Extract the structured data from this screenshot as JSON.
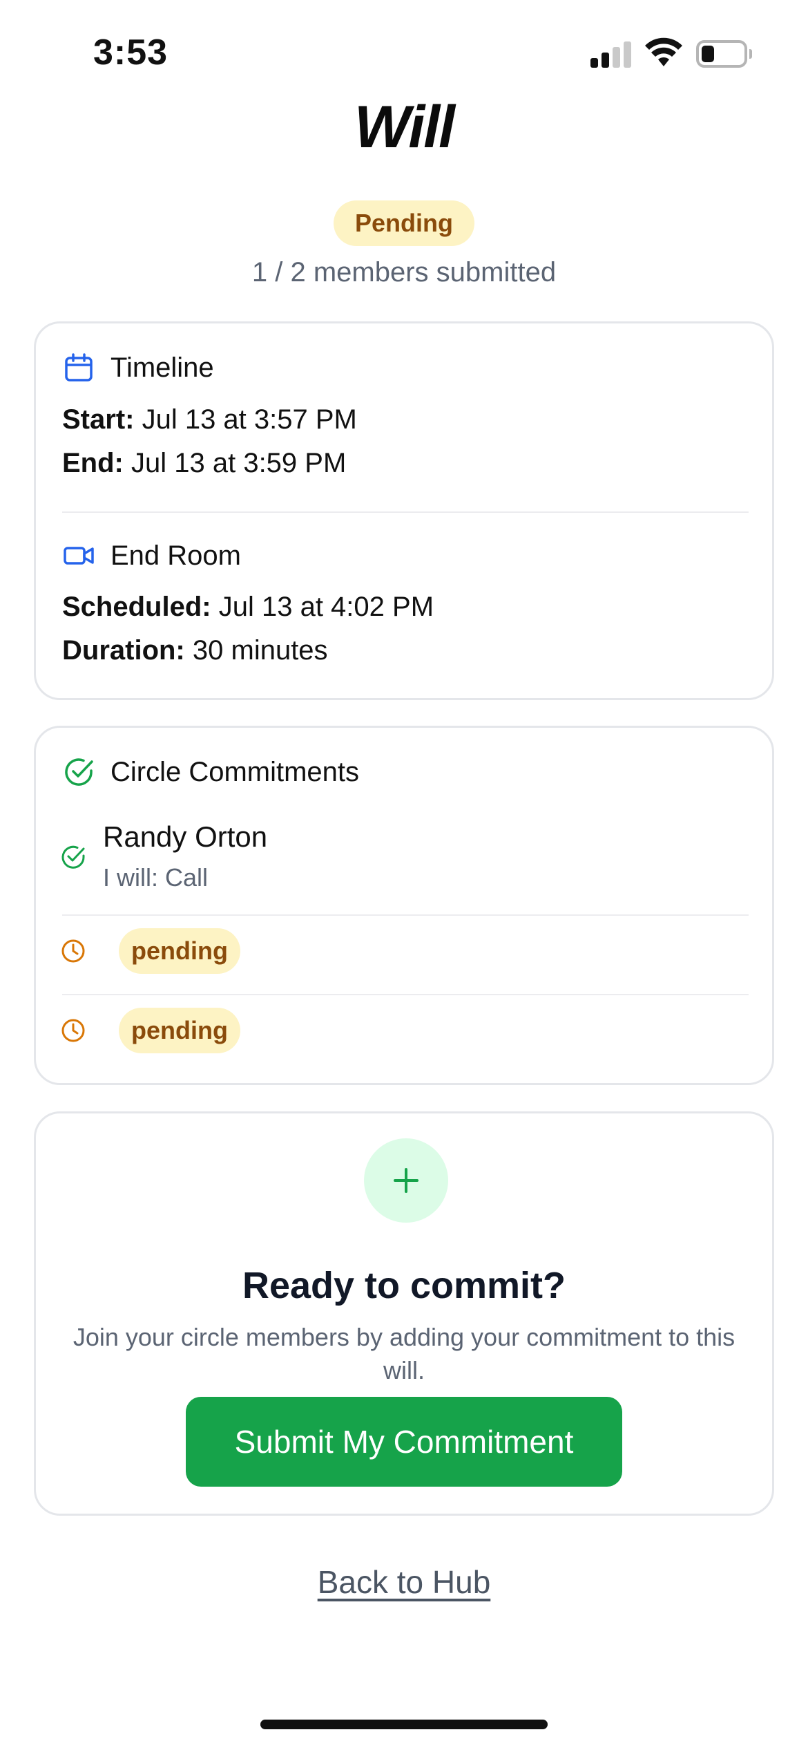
{
  "status_bar": {
    "time": "3:53"
  },
  "header": {
    "title": "Will",
    "status_badge": "Pending",
    "submitted_count": "1 / 2 members submitted"
  },
  "timeline": {
    "title": "Timeline",
    "icon": "calendar-icon",
    "start_label": "Start:",
    "start_value": "Jul 13 at 3:57 PM",
    "end_label": "End:",
    "end_value": "Jul 13 at 3:59 PM"
  },
  "end_room": {
    "title": "End Room",
    "icon": "video-camera-icon",
    "scheduled_label": "Scheduled:",
    "scheduled_value": "Jul 13 at 4:02 PM",
    "duration_label": "Duration:",
    "duration_value": "30 minutes"
  },
  "commitments": {
    "title": "Circle Commitments",
    "icon": "check-circle-icon",
    "members": [
      {
        "name": "Randy Orton",
        "commitment": "I will: Call",
        "status": "submitted"
      },
      {
        "status_label": "pending"
      },
      {
        "status_label": "pending"
      }
    ]
  },
  "cta": {
    "title": "Ready to commit?",
    "description": "Join your circle members by adding your commitment to this will.",
    "button_label": "Submit My Commitment"
  },
  "footer": {
    "back_link": "Back to Hub"
  },
  "colors": {
    "accent_green": "#16a34a",
    "pending_bg": "#fdf3c4",
    "pending_text": "#8a4b0b",
    "icon_blue": "#2563eb",
    "pending_icon": "#d97706"
  }
}
